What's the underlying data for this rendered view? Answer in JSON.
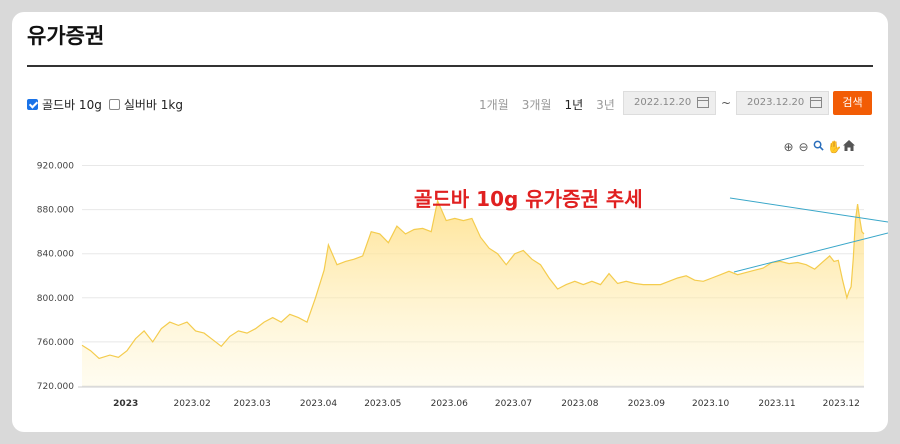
{
  "page": {
    "title": "유가증권"
  },
  "filters": [
    {
      "label": "골드바 10g",
      "checked": true
    },
    {
      "label": "실버바 1kg",
      "checked": false
    }
  ],
  "periods": [
    {
      "label": "1개월",
      "active": false
    },
    {
      "label": "3개월",
      "active": false
    },
    {
      "label": "1년",
      "active": true
    },
    {
      "label": "3년",
      "active": false
    }
  ],
  "dates": {
    "start": "2022.12.20",
    "separator": "~",
    "end": "2023.12.20"
  },
  "search_label": "검색",
  "toolbar_icons": [
    "zoom-in-icon",
    "zoom-out-icon",
    "magnifier-icon",
    "pan-hand-icon",
    "home-icon"
  ],
  "colors": {
    "accent": "#f25c05",
    "line": "#f4cc4e",
    "fill": "#ffe9a0",
    "annotation": "#e02020",
    "trendline": "#3aa7c9"
  },
  "chart_data": {
    "type": "area",
    "title": "",
    "annotation": "골드바 10g 유가증권 추세",
    "xlabel": "",
    "ylabel": "",
    "ylim": [
      720000,
      925000
    ],
    "yticks": [
      {
        "label": "920.000",
        "value": 920000
      },
      {
        "label": "880.000",
        "value": 880000
      },
      {
        "label": "840.000",
        "value": 840000
      },
      {
        "label": "800.000",
        "value": 800000
      },
      {
        "label": "760.000",
        "value": 760000
      },
      {
        "label": "720.000",
        "value": 720000
      }
    ],
    "xlim": [
      "2022-12-20",
      "2023-12-20"
    ],
    "xticks": [
      {
        "label": "2023",
        "date": "2023-01-01"
      },
      {
        "label": "2023.02",
        "date": "2023-02-01"
      },
      {
        "label": "2023.03",
        "date": "2023-03-01"
      },
      {
        "label": "2023.04",
        "date": "2023-04-01"
      },
      {
        "label": "2023.05",
        "date": "2023-05-01"
      },
      {
        "label": "2023.06",
        "date": "2023-06-01"
      },
      {
        "label": "2023.07",
        "date": "2023-07-01"
      },
      {
        "label": "2023.08",
        "date": "2023-08-01"
      },
      {
        "label": "2023.09",
        "date": "2023-09-01"
      },
      {
        "label": "2023.10",
        "date": "2023-10-01"
      },
      {
        "label": "2023.11",
        "date": "2023-11-01"
      },
      {
        "label": "2023.12",
        "date": "2023-12-01"
      }
    ],
    "grid": true,
    "series": [
      {
        "points": [
          [
            "2022-12-20",
            757000
          ],
          [
            "2022-12-24",
            752000
          ],
          [
            "2022-12-28",
            745000
          ],
          [
            "2023-01-02",
            748000
          ],
          [
            "2023-01-06",
            746000
          ],
          [
            "2023-01-10",
            752000
          ],
          [
            "2023-01-14",
            763000
          ],
          [
            "2023-01-18",
            770000
          ],
          [
            "2023-01-22",
            760000
          ],
          [
            "2023-01-26",
            772000
          ],
          [
            "2023-01-30",
            778000
          ],
          [
            "2023-02-03",
            775000
          ],
          [
            "2023-02-07",
            778000
          ],
          [
            "2023-02-11",
            770000
          ],
          [
            "2023-02-15",
            768000
          ],
          [
            "2023-02-19",
            762000
          ],
          [
            "2023-02-23",
            756000
          ],
          [
            "2023-02-27",
            765000
          ],
          [
            "2023-03-03",
            770000
          ],
          [
            "2023-03-07",
            768000
          ],
          [
            "2023-03-11",
            772000
          ],
          [
            "2023-03-15",
            778000
          ],
          [
            "2023-03-19",
            782000
          ],
          [
            "2023-03-23",
            778000
          ],
          [
            "2023-03-27",
            785000
          ],
          [
            "2023-03-31",
            782000
          ],
          [
            "2023-04-04",
            778000
          ],
          [
            "2023-04-08",
            800000
          ],
          [
            "2023-04-12",
            825000
          ],
          [
            "2023-04-14",
            848000
          ],
          [
            "2023-04-18",
            830000
          ],
          [
            "2023-04-22",
            833000
          ],
          [
            "2023-04-26",
            835000
          ],
          [
            "2023-04-30",
            838000
          ],
          [
            "2023-05-04",
            860000
          ],
          [
            "2023-05-08",
            858000
          ],
          [
            "2023-05-12",
            850000
          ],
          [
            "2023-05-16",
            865000
          ],
          [
            "2023-05-20",
            858000
          ],
          [
            "2023-05-24",
            862000
          ],
          [
            "2023-05-28",
            863000
          ],
          [
            "2023-06-01",
            860000
          ],
          [
            "2023-06-04",
            888000
          ],
          [
            "2023-06-08",
            870000
          ],
          [
            "2023-06-12",
            872000
          ],
          [
            "2023-06-16",
            870000
          ],
          [
            "2023-06-20",
            872000
          ],
          [
            "2023-06-24",
            855000
          ],
          [
            "2023-06-28",
            845000
          ],
          [
            "2023-07-02",
            840000
          ],
          [
            "2023-07-06",
            830000
          ],
          [
            "2023-07-10",
            840000
          ],
          [
            "2023-07-14",
            843000
          ],
          [
            "2023-07-18",
            835000
          ],
          [
            "2023-07-22",
            830000
          ],
          [
            "2023-07-26",
            818000
          ],
          [
            "2023-07-30",
            808000
          ],
          [
            "2023-08-03",
            812000
          ],
          [
            "2023-08-07",
            815000
          ],
          [
            "2023-08-11",
            812000
          ],
          [
            "2023-08-15",
            815000
          ],
          [
            "2023-08-19",
            812000
          ],
          [
            "2023-08-23",
            822000
          ],
          [
            "2023-08-27",
            813000
          ],
          [
            "2023-08-31",
            815000
          ],
          [
            "2023-09-04",
            813000
          ],
          [
            "2023-09-08",
            812000
          ],
          [
            "2023-09-12",
            812000
          ],
          [
            "2023-09-16",
            812000
          ],
          [
            "2023-09-20",
            815000
          ],
          [
            "2023-09-24",
            818000
          ],
          [
            "2023-09-28",
            820000
          ],
          [
            "2023-10-02",
            816000
          ],
          [
            "2023-10-06",
            815000
          ],
          [
            "2023-10-10",
            818000
          ],
          [
            "2023-10-14",
            821000
          ],
          [
            "2023-10-18",
            824000
          ],
          [
            "2023-10-22",
            821000
          ],
          [
            "2023-10-26",
            823000
          ],
          [
            "2023-10-30",
            825000
          ],
          [
            "2023-11-03",
            827000
          ],
          [
            "2023-11-07",
            832000
          ],
          [
            "2023-11-11",
            833000
          ],
          [
            "2023-11-15",
            831000
          ],
          [
            "2023-11-19",
            832000
          ],
          [
            "2023-11-23",
            830000
          ],
          [
            "2023-11-27",
            826000
          ],
          [
            "2023-12-01",
            833000
          ],
          [
            "2023-12-04",
            838000
          ],
          [
            "2023-12-06",
            833000
          ],
          [
            "2023-12-08",
            834000
          ],
          [
            "2023-12-10",
            816000
          ],
          [
            "2023-12-12",
            800000
          ],
          [
            "2023-12-13",
            806000
          ],
          [
            "2023-12-14",
            810000
          ],
          [
            "2023-12-15",
            836000
          ],
          [
            "2023-12-16",
            870000
          ],
          [
            "2023-12-17",
            885000
          ],
          [
            "2023-12-18",
            872000
          ],
          [
            "2023-12-19",
            860000
          ],
          [
            "2023-12-20",
            858000
          ]
        ]
      }
    ]
  }
}
